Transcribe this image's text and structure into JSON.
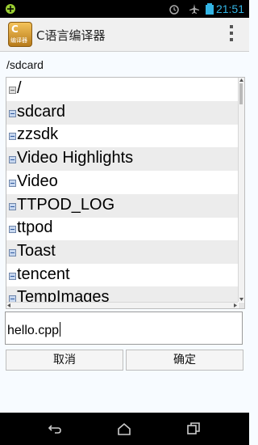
{
  "status_bar": {
    "time": "21:51"
  },
  "app": {
    "title": "C语言编译器",
    "icon_text": "C",
    "icon_sub": "编译器"
  },
  "current_path": "/sdcard",
  "file_list": [
    {
      "name": "/",
      "type": "up"
    },
    {
      "name": "sdcard",
      "type": "folder"
    },
    {
      "name": "zzsdk",
      "type": "folder"
    },
    {
      "name": "Video Highlights",
      "type": "folder"
    },
    {
      "name": "Video",
      "type": "folder"
    },
    {
      "name": "TTPOD_LOG",
      "type": "folder"
    },
    {
      "name": "ttpod",
      "type": "folder"
    },
    {
      "name": "Toast",
      "type": "folder"
    },
    {
      "name": "tencent",
      "type": "folder"
    },
    {
      "name": "TempImages",
      "type": "folder"
    }
  ],
  "filename_input": {
    "value": "hello.cpp"
  },
  "buttons": {
    "cancel": "取消",
    "ok": "确定"
  }
}
